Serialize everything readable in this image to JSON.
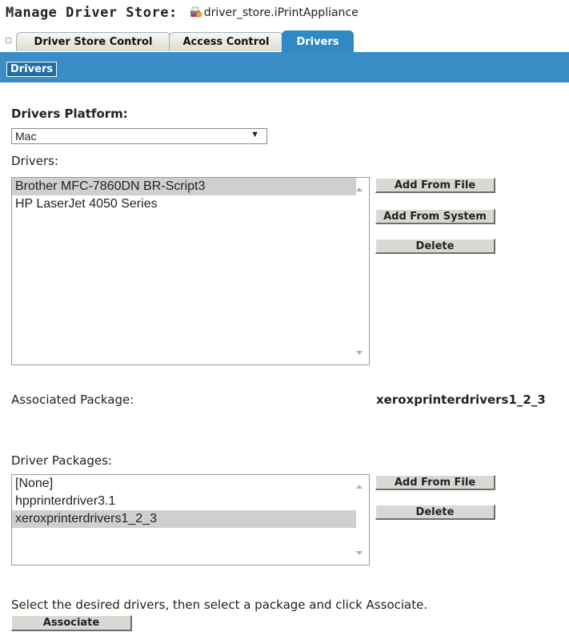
{
  "header": {
    "label": "Manage Driver Store:",
    "object_name": "driver_store.iPrintAppliance"
  },
  "tabs": [
    {
      "label": "Driver Store Control",
      "active": false
    },
    {
      "label": "Access Control",
      "active": false
    },
    {
      "label": "Drivers",
      "active": true
    }
  ],
  "subtab": {
    "label": "Drivers"
  },
  "platform": {
    "label": "Drivers Platform:",
    "selected": "Mac"
  },
  "drivers": {
    "label": "Drivers:",
    "items": [
      {
        "text": "Brother MFC-7860DN BR-Script3",
        "selected": true
      },
      {
        "text": "HP LaserJet 4050 Series",
        "selected": false
      }
    ],
    "buttons": {
      "add_from_file": "Add From File",
      "add_from_system": "Add From System",
      "delete": "Delete"
    }
  },
  "associated_package": {
    "label": "Associated Package:",
    "value": "xeroxprinterdrivers1_2_3"
  },
  "packages": {
    "label": "Driver Packages:",
    "items": [
      {
        "text": "[None]",
        "selected": false
      },
      {
        "text": "hpprinterdriver3.1",
        "selected": false
      },
      {
        "text": "xeroxprinterdrivers1_2_3",
        "selected": true
      }
    ],
    "buttons": {
      "add_from_file": "Add From File",
      "delete": "Delete"
    }
  },
  "instructions": "Select the desired drivers, then select a package and click Associate.",
  "associate_button": "Associate"
}
